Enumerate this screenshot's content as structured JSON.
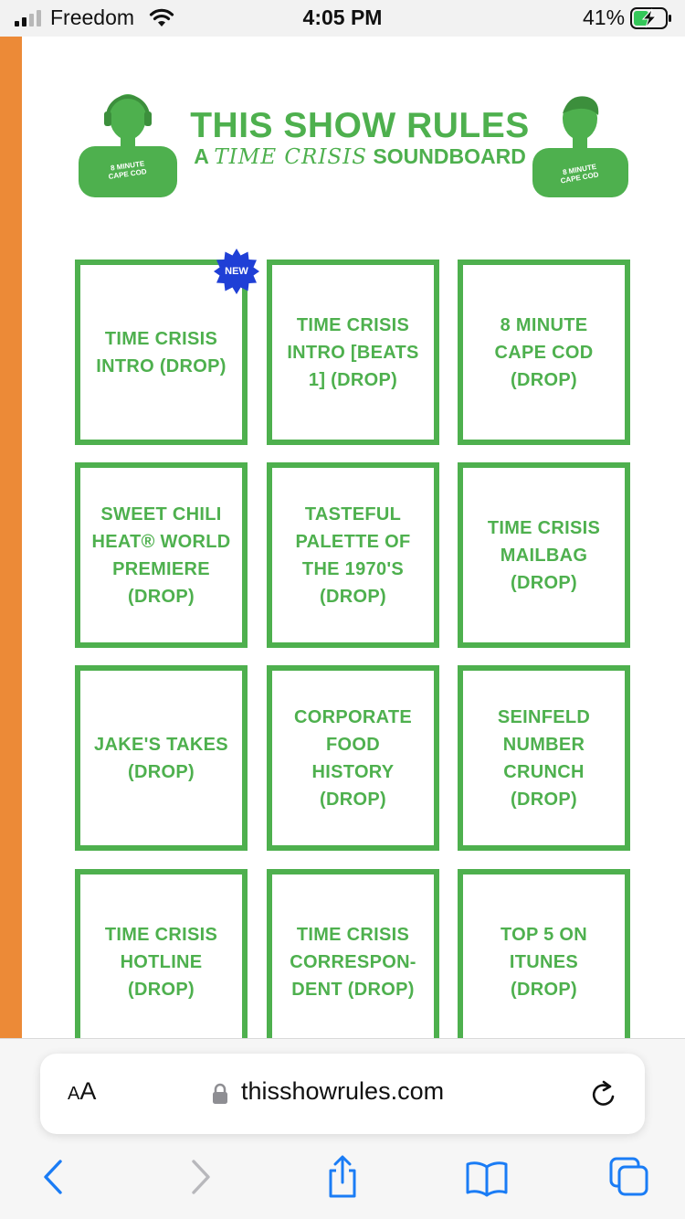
{
  "status_bar": {
    "carrier": "Freedom",
    "time": "4:05 PM",
    "battery": "41%",
    "icons": [
      "signal-icon",
      "wifi-icon",
      "battery-charging-icon"
    ]
  },
  "banner": {
    "title": "THIS SHOW RULES",
    "subtitle_prefix": "A",
    "subtitle_accent": "TIME CRISIS",
    "subtitle_suffix": "SOUNDBOARD",
    "shirt_text": "8 MINUTE CAPE COD"
  },
  "badge": {
    "label": "NEW"
  },
  "tiles": [
    {
      "label": "TIME CRISIS INTRO (DROP)"
    },
    {
      "label": "TIME CRISIS INTRO [BEATS 1] (DROP)"
    },
    {
      "label": "8 MINUTE CAPE COD (DROP)"
    },
    {
      "label": "SWEET CHILI HEAT® WORLD PREMIERE (DROP)"
    },
    {
      "label": "TASTEFUL PALETTE OF THE 1970'S (DROP)"
    },
    {
      "label": "TIME CRISIS MAILBAG (DROP)"
    },
    {
      "label": "JAKE'S TAKES (DROP)"
    },
    {
      "label": "CORPORATE FOOD HISTORY (DROP)"
    },
    {
      "label": "SEINFELD NUMBER CRUNCH (DROP)"
    },
    {
      "label": "TIME CRISIS HOTLINE (DROP)"
    },
    {
      "label": "TIME CRISIS CORRESPON-DENT (DROP)"
    },
    {
      "label": "TOP 5 ON ITUNES (DROP)"
    }
  ],
  "browser": {
    "aa_large": "A",
    "aa_small": "A",
    "url": "thisshowrules.com",
    "icons": [
      "lock-icon",
      "reload-icon",
      "back-icon",
      "forward-icon",
      "share-icon",
      "bookmarks-icon",
      "tabs-icon"
    ]
  },
  "colors": {
    "accent_green": "#4eb04e",
    "strip_orange": "#ec8a37",
    "badge_blue": "#1f3fd6",
    "ios_blue": "#1a7cf5"
  }
}
